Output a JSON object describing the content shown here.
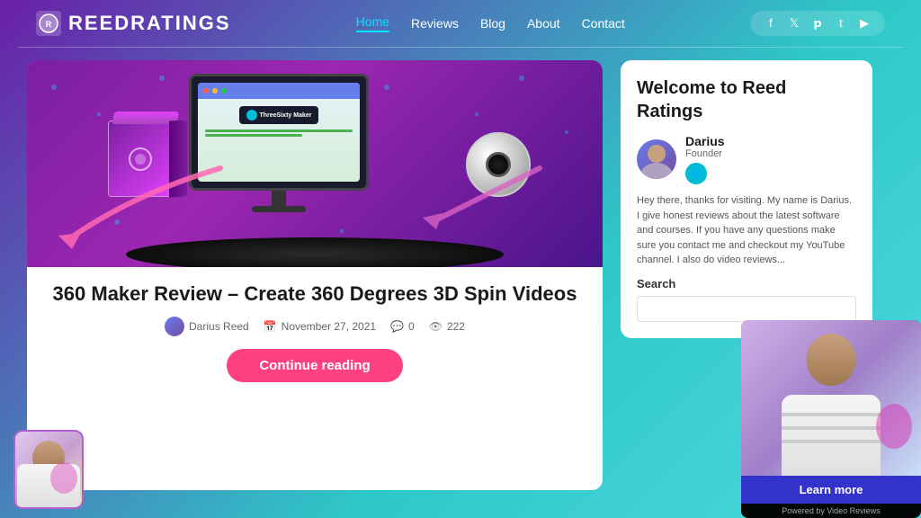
{
  "site": {
    "logo": "ReedRatings",
    "logo_part1": "Reed",
    "logo_part2": "Ratings"
  },
  "nav": {
    "links": [
      {
        "label": "Home",
        "active": true
      },
      {
        "label": "Reviews",
        "active": false
      },
      {
        "label": "Blog",
        "active": false
      },
      {
        "label": "About",
        "active": false
      },
      {
        "label": "Contact",
        "active": false
      }
    ],
    "social": [
      "f",
      "t",
      "p",
      "t",
      "yt"
    ]
  },
  "post": {
    "title": "360 Maker Review – Create 360 Degrees 3D Spin Videos",
    "author": "Darius Reed",
    "date": "November 27, 2021",
    "comments": "0",
    "views": "222",
    "continue_label": "Continue reading"
  },
  "sidebar": {
    "welcome_title": "Welcome to Reed Ratings",
    "author_name": "Darius",
    "author_role": "Founder",
    "bio_text": "Hey there, thanks for visiting. My name is Darius. I give honest reviews about the latest software and courses. If you have any questions make sure you contact me and checkout my YouTube channel. I also do video reviews...",
    "search_label": "Search",
    "search_placeholder": ""
  },
  "video_widget": {
    "learn_more_label": "Learn more",
    "powered_by": "Powered by Video Reviews"
  },
  "colors": {
    "accent_pink": "#ff4081",
    "accent_cyan": "#00bcd4",
    "nav_active": "#00e5ff",
    "learn_more_bg": "#3333cc",
    "bg_gradient_start": "#6a1fa8",
    "bg_gradient_end": "#4dd9e0"
  }
}
